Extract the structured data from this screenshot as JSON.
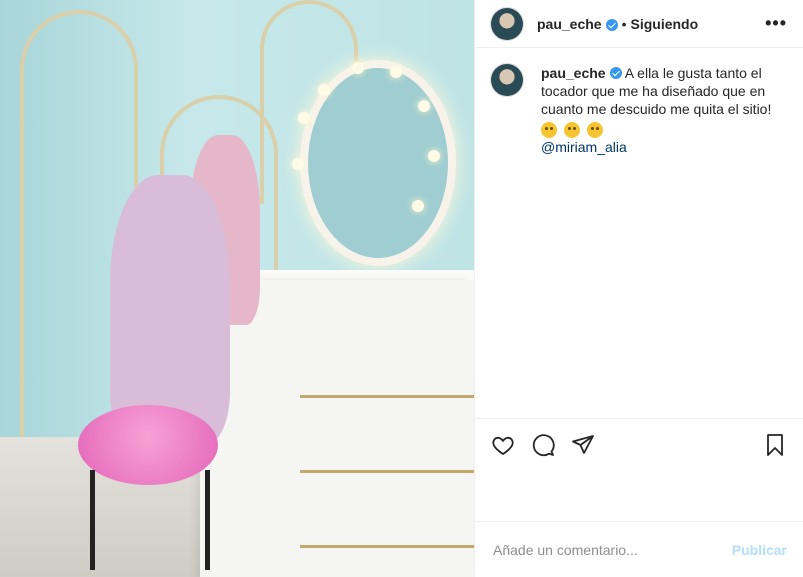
{
  "post": {
    "username": "pau_eche",
    "separator": "•",
    "follow_status": "Siguiendo",
    "more": "•••"
  },
  "caption": {
    "username": "pau_eche",
    "text": "A ella le gusta tanto el tocador que me ha diseñado que en cuanto me descuido me quita el sitio!",
    "emojis": [
      "smiling-face-emoji",
      "grinning-face-emoji",
      "rolling-laughing-emoji"
    ],
    "mention": "@miriam_alia"
  },
  "actions": {
    "icons": [
      "heart-icon",
      "comment-icon",
      "share-icon",
      "bookmark-icon"
    ]
  },
  "comment": {
    "placeholder": "Añade un comentario...",
    "publish_label": "Publicar"
  },
  "colors": {
    "verified": "#3897f0",
    "publish_disabled": "#b2dffc",
    "mention": "#003569"
  }
}
